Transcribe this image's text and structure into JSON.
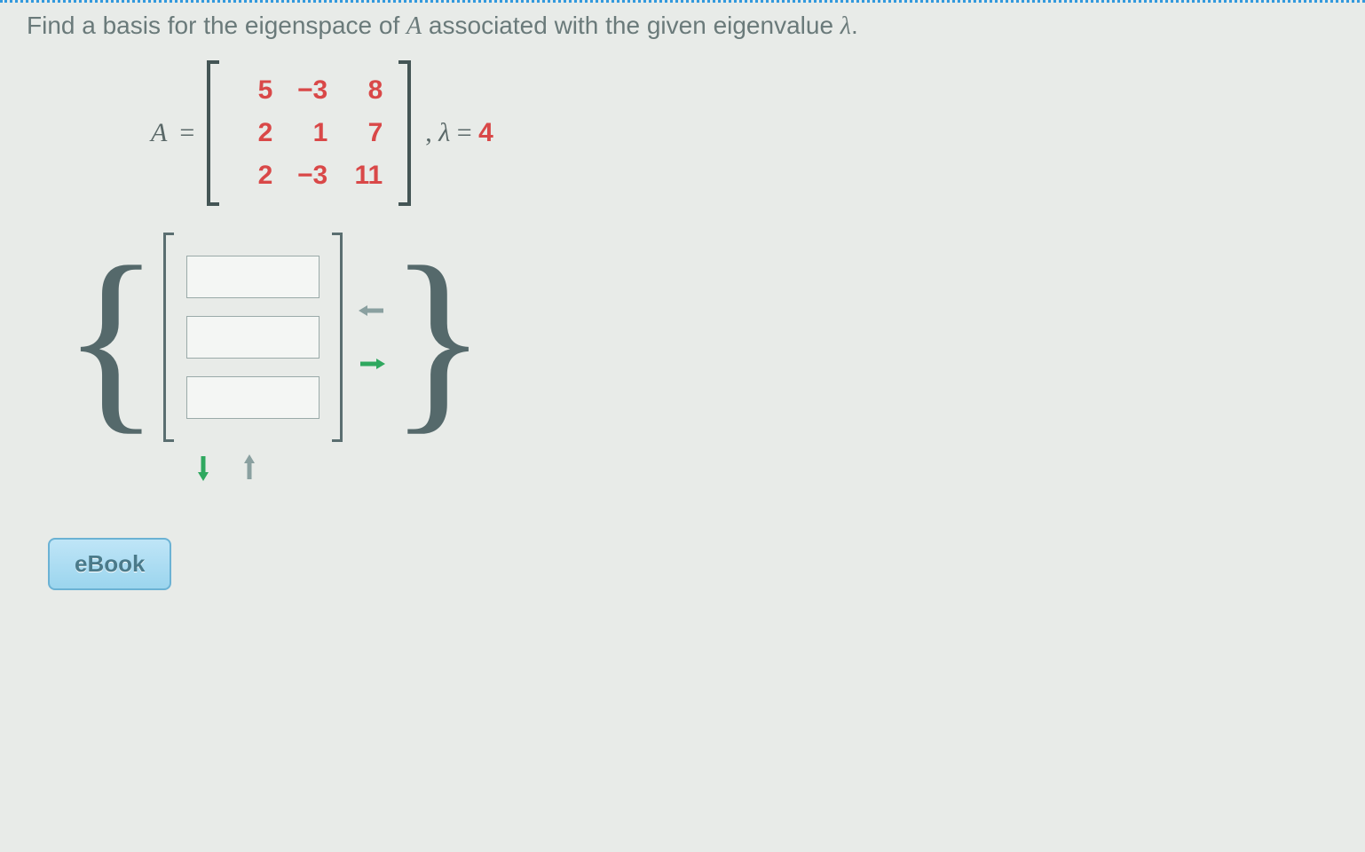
{
  "question": {
    "prefix": "Find a basis for the eigenspace of ",
    "var_A": "A",
    "mid": " associated with the given eigenvalue ",
    "var_lambda": "λ",
    "suffix": "."
  },
  "matrix": {
    "label": "A",
    "equals": "=",
    "rows": [
      [
        "5",
        "−3",
        "8"
      ],
      [
        "2",
        "1",
        "7"
      ],
      [
        "2",
        "−3",
        "11"
      ]
    ],
    "comma": ",",
    "lambda_label": "λ",
    "lambda_eq": "=",
    "lambda_value": "4"
  },
  "answer_inputs": {
    "placeholder": "",
    "values": [
      "",
      "",
      ""
    ]
  },
  "arrows": {
    "left": "←",
    "right": "→",
    "down": "↓",
    "up": "↑"
  },
  "ebook_label": "eBook"
}
